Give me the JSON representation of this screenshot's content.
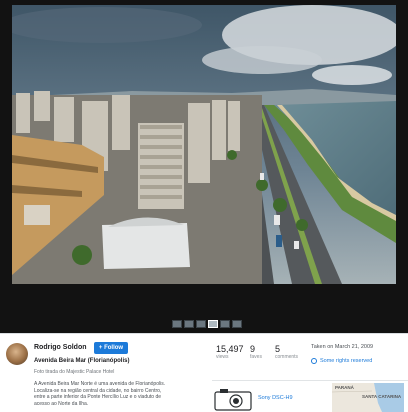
{
  "author": {
    "name": "Rodrigo Soldon",
    "follow_label": "+ Follow"
  },
  "photo": {
    "title": "Avenida Beira Mar (Florianópolis)",
    "subtitle": "Foto tirada do Majestic Palace Hotel",
    "description": "A Avenida Beira Mar Norte é uma avenida de Florianópolis. Localiza-se na região central da cidade, no bairro Centro, entre a parte inferior da Ponte Hercílio Luz e o viaduto de acesso ao Norte da Ilha."
  },
  "stats": [
    {
      "value": "15,497",
      "label": "views"
    },
    {
      "value": "9",
      "label": "faves"
    },
    {
      "value": "5",
      "label": "comments"
    }
  ],
  "taken": "Taken on March 21, 2009",
  "rights": "Some rights reserved",
  "camera": {
    "name": "Sony DSC-H9",
    "icon": "camera-icon"
  },
  "map": {
    "labels": [
      "PARANÁ",
      "SANTA CATARINA"
    ]
  },
  "filmstrip": {
    "count": 6,
    "active_index": 3
  },
  "colors": {
    "accent": "#1c7ad9",
    "viewer_bg": "#121212"
  }
}
